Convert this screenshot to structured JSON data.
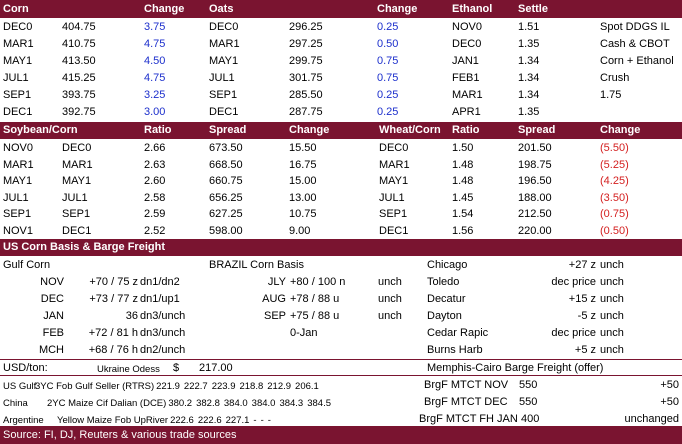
{
  "top": {
    "header": [
      "Corn",
      "Change",
      "Oats",
      "",
      "Change",
      "Ethanol",
      "Settle"
    ],
    "rows": [
      [
        "DEC0",
        "404.75",
        "3.75",
        "DEC0",
        "296.25",
        "0.25",
        "NOV0",
        "1.51",
        "Spot DDGS IL"
      ],
      [
        "MAR1",
        "410.75",
        "4.75",
        "MAR1",
        "297.25",
        "0.50",
        "DEC0",
        "1.35",
        "Cash & CBOT"
      ],
      [
        "MAY1",
        "413.50",
        "4.50",
        "MAY1",
        "299.75",
        "0.75",
        "JAN1",
        "1.34",
        "Corn + Ethanol"
      ],
      [
        "JUL1",
        "415.25",
        "4.75",
        "JUL1",
        "301.75",
        "0.75",
        "FEB1",
        "1.34",
        "Crush"
      ],
      [
        "SEP1",
        "393.75",
        "3.25",
        "SEP1",
        "285.50",
        "0.25",
        "MAR1",
        "1.34",
        "1.75"
      ],
      [
        "DEC1",
        "392.75",
        "3.00",
        "DEC1",
        "287.75",
        "0.25",
        "APR1",
        "1.35",
        ""
      ]
    ]
  },
  "spread": {
    "header": [
      "Soybean/Corn",
      "Ratio",
      "Spread",
      "Change",
      "Wheat/Corn",
      "Ratio",
      "Spread",
      "Change"
    ],
    "rows": [
      [
        "NOV0",
        "DEC0",
        "2.66",
        "673.50",
        "15.50",
        "DEC0",
        "1.50",
        "201.50",
        "(5.50)"
      ],
      [
        "MAR1",
        "MAR1",
        "2.63",
        "668.50",
        "16.75",
        "MAR1",
        "1.48",
        "198.75",
        "(5.25)"
      ],
      [
        "MAY1",
        "MAY1",
        "2.60",
        "660.75",
        "15.00",
        "MAY1",
        "1.48",
        "196.50",
        "(4.25)"
      ],
      [
        "JUL1",
        "JUL1",
        "2.58",
        "656.25",
        "13.00",
        "JUL1",
        "1.45",
        "188.00",
        "(3.50)"
      ],
      [
        "SEP1",
        "SEP1",
        "2.59",
        "627.25",
        "10.75",
        "SEP1",
        "1.54",
        "212.50",
        "(0.75)"
      ],
      [
        "NOV1",
        "DEC1",
        "2.52",
        "598.00",
        "9.00",
        "DEC1",
        "1.56",
        "220.00",
        "(0.50)"
      ]
    ]
  },
  "basis": {
    "title": "US Corn Basis & Barge Freight",
    "gulf_label": "Gulf Corn",
    "brazil_label": "BRAZIL Corn Basis",
    "gulf_rows": [
      [
        "NOV",
        "+70 / 75 z",
        "dn1/dn2"
      ],
      [
        "DEC",
        "+73 / 77 z",
        "dn1/up1"
      ],
      [
        "JAN",
        "36",
        "dn3/unch"
      ],
      [
        "FEB",
        "+72 / 81 h",
        "dn3/unch"
      ],
      [
        "MCH",
        "+68 / 76 h",
        "dn2/unch"
      ]
    ],
    "brazil_rows": [
      [
        "JLY",
        "+80 / 100 n",
        "unch"
      ],
      [
        "AUG",
        "+78 / 88 u",
        "unch"
      ],
      [
        "SEP",
        "+75 / 88 u",
        "unch"
      ],
      [
        "",
        "0-Jan",
        ""
      ]
    ],
    "city_rows": [
      [
        "Chicago",
        "+27 z",
        "unch"
      ],
      [
        "Toledo",
        "dec price",
        "unch"
      ],
      [
        "Decatur",
        "+15 z",
        "unch"
      ],
      [
        "Dayton",
        "-5 z",
        "unch"
      ],
      [
        "Cedar Rapic",
        "dec price",
        "unch"
      ],
      [
        "Burns Harb",
        "+5 z",
        "unch"
      ]
    ]
  },
  "bottom": {
    "usd_label": "USD/ton:",
    "ukraine_label": "Ukraine Odess",
    "ukraine_currency": "$",
    "ukraine_value": "217.00",
    "barge_title": "Memphis-Cairo Barge Freight (offer)",
    "lines": [
      [
        "US Gulf",
        "3YC Fob Gulf Seller (RTRS)",
        "221.9",
        "222.7",
        "223.9",
        "218.8",
        "212.9",
        "206.1"
      ],
      [
        "China",
        "2YC Maize Cif Dalian (DCE)",
        "380.2",
        "382.8",
        "384.0",
        "384.0",
        "384.3",
        "384.5"
      ],
      [
        "Argentine",
        "Yellow Maize Fob UpRiver",
        "222.6",
        "222.6",
        "227.1",
        "-",
        "-",
        "-"
      ]
    ],
    "barge_rows": [
      [
        "BrgF MTCT NOV",
        "550",
        "+50"
      ],
      [
        "BrgF MTCT DEC",
        "550",
        "+50"
      ],
      [
        "BrgF MTCT FH JAN",
        "400",
        "unchanged"
      ]
    ]
  },
  "source": "Source: FI, DJ, Reuters & various trade sources"
}
